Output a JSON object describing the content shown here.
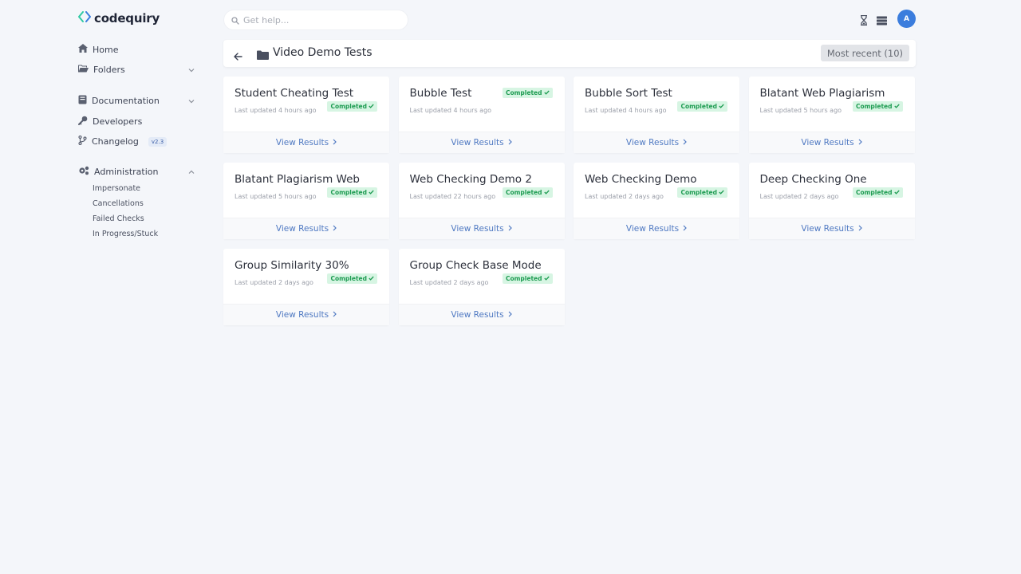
{
  "brand": {
    "name": "codequiry"
  },
  "sidebar": {
    "home": "Home",
    "folders": "Folders",
    "documentation": "Documentation",
    "developers": "Developers",
    "changelog": "Changelog",
    "changelog_version": "v2.3",
    "administration": "Administration",
    "admin_items": [
      "Impersonate",
      "Cancellations",
      "Failed Checks",
      "In Progress/Stuck"
    ]
  },
  "topbar": {
    "search_placeholder": "Get help...",
    "avatar_initial": "A"
  },
  "header": {
    "title": "Video Demo Tests",
    "sort_label": "Most recent (10)"
  },
  "cards": [
    {
      "title": "Student Cheating Test",
      "updated": "Last updated 4 hours ago",
      "status": "Completed",
      "link": "View Results",
      "status_top": false
    },
    {
      "title": "Bubble Test",
      "updated": "Last updated 4 hours ago",
      "status": "Completed",
      "link": "View Results",
      "status_top": true
    },
    {
      "title": "Bubble Sort Test",
      "updated": "Last updated 4 hours ago",
      "status": "Completed",
      "link": "View Results",
      "status_top": false
    },
    {
      "title": "Blatant Web Plagiarism",
      "updated": "Last updated 5 hours ago",
      "status": "Completed",
      "link": "View Results",
      "status_top": false
    },
    {
      "title": "Blatant Plagiarism Web",
      "updated": "Last updated 5 hours ago",
      "status": "Completed",
      "link": "View Results",
      "status_top": false
    },
    {
      "title": "Web Checking Demo 2",
      "updated": "Last updated 22 hours ago",
      "status": "Completed",
      "link": "View Results",
      "status_top": false
    },
    {
      "title": "Web Checking Demo",
      "updated": "Last updated 2 days ago",
      "status": "Completed",
      "link": "View Results",
      "status_top": false
    },
    {
      "title": "Deep Checking One",
      "updated": "Last updated 2 days ago",
      "status": "Completed",
      "link": "View Results",
      "status_top": false
    },
    {
      "title": "Group Similarity 30%",
      "updated": "Last updated 2 days ago",
      "status": "Completed",
      "link": "View Results",
      "status_top": false
    },
    {
      "title": "Group Check Base Mode",
      "updated": "Last updated 2 days ago",
      "status": "Completed",
      "link": "View Results",
      "status_top": false
    }
  ],
  "colors": {
    "accent": "#3b7ddd",
    "link": "#4f79c2",
    "status_bg": "#d7f5e3",
    "status_text": "#1e9c52",
    "background": "#f4f6fa"
  }
}
